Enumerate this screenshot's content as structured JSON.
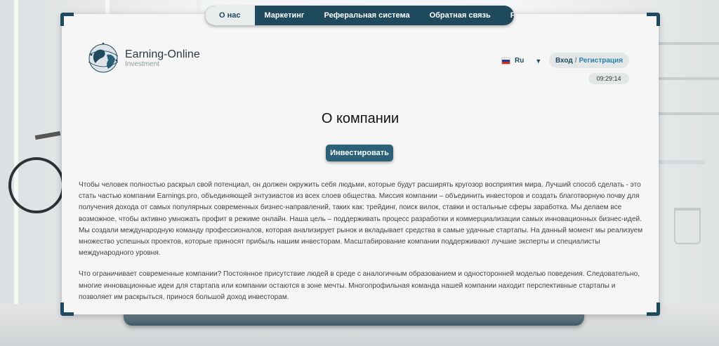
{
  "colors": {
    "accent": "#1f4a5e",
    "button": "#2a6178",
    "link": "#2a7fa8"
  },
  "nav": {
    "items": [
      {
        "label": "О нас",
        "active": true
      },
      {
        "label": "Маркетинг",
        "active": false
      },
      {
        "label": "Реферальная система",
        "active": false
      },
      {
        "label": "Обратная связь",
        "active": false
      },
      {
        "label": "Faq",
        "active": false
      }
    ]
  },
  "logo": {
    "name": "Earning-Online",
    "subtitle": "Investment",
    "icon": "globe-icon"
  },
  "language": {
    "selected": "Ru",
    "flag": "russia-flag-icon"
  },
  "auth": {
    "login": "Вход",
    "separator": "/",
    "register": "Регистрация"
  },
  "clock": "09:29:14",
  "page": {
    "title": "О компании",
    "invest_button": "Инвестировать",
    "paragraphs": [
      "Чтобы человек полностью раскрыл свой потенциал, он должен окружить себя людьми, которые будут расширять кругозор восприятия мира. Лучший способ сделать - это стать частью компании Earnings.pro, объединяющей энтузиастов из всех слоев общества. Миссия компании – объединить инвесторов и создать благотворную почву для получения дохода от самых популярных современных бизнес-направлений, таких как: трейдинг, поиск вилок, ставки и остальные сферы заработка. Мы делаем все возможное, чтобы активно умножать профит в режиме онлайн. Наша цель – поддерживать процесс разработки и коммерциализации самых инновационных бизнес-идей. Мы создали международную команду профессионалов, которая анализирует рынок и вкладывает средства в самые удачные стартапы. На данный момент мы реализуем множество успешных проектов, которые приносят прибыль нашим инвесторам. Масштабирование компании поддерживают лучшие эксперты и специалисты международного уровня.",
      "Что ограничивает современные компании? Постоянное присутствие людей в среде с аналогичным образованием и односторонней моделью поведения. Следовательно, многие инновационные идеи для стартапа или компании остаются в зоне мечты. Многопрофильная команда нашей компании находит перспективные стартапы и позволяет им раскрыться, принося большой доход инвесторам."
    ]
  }
}
